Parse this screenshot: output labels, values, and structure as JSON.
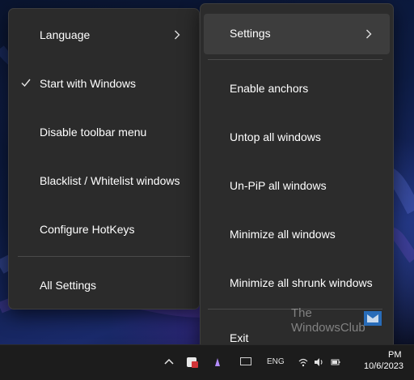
{
  "left_menu": {
    "items": [
      {
        "label": "Language",
        "has_submenu": true,
        "checked": false
      },
      {
        "label": "Start with Windows",
        "has_submenu": false,
        "checked": true
      },
      {
        "label": "Disable toolbar menu",
        "has_submenu": false,
        "checked": false
      },
      {
        "label": "Blacklist / Whitelist windows",
        "has_submenu": false,
        "checked": false
      },
      {
        "label": "Configure HotKeys",
        "has_submenu": false,
        "checked": false
      }
    ],
    "footer_item": {
      "label": "All Settings"
    }
  },
  "right_menu": {
    "header_item": {
      "label": "Settings",
      "has_submenu": true,
      "highlighted": true
    },
    "items": [
      {
        "label": "Enable anchors"
      },
      {
        "label": "Untop all windows"
      },
      {
        "label": "Un-PiP all windows"
      },
      {
        "label": "Minimize all windows"
      },
      {
        "label": "Minimize all shrunk windows"
      }
    ],
    "footer_item": {
      "label": "Exit"
    }
  },
  "taskbar": {
    "language_indicator": "ENG",
    "clock_time": "PM",
    "clock_date": "10/6/2023",
    "icons": [
      "chevron-up-icon",
      "app-tray-icon",
      "pen-icon",
      "display-icon",
      "wifi-icon",
      "volume-icon",
      "battery-icon"
    ]
  },
  "watermark": {
    "line1": "The",
    "line2": "WindowsClub"
  },
  "colors": {
    "menu_background": "#2b2b2b",
    "menu_highlight": "#3d3d3d",
    "text": "#ffffff",
    "taskbar": "#1c1c1c"
  }
}
